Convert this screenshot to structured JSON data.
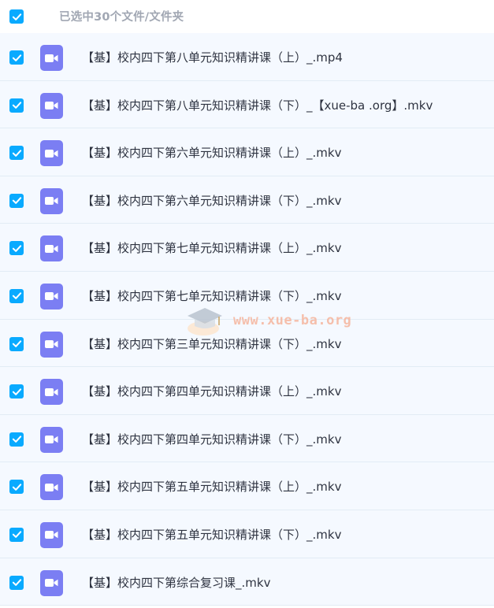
{
  "header": {
    "label": "已选中30个文件/文件夹"
  },
  "colors": {
    "checkbox": "#09aaff",
    "video_icon": "#7b7ef3",
    "row_bg": "#f5f9ff",
    "watermark_text": "#f6b9a3"
  },
  "files": [
    {
      "name": "【基】校内四下第八单元知识精讲课（上）_.mp4",
      "icon": "video-icon",
      "checked": true
    },
    {
      "name": "【基】校内四下第八单元知识精讲课（下）_【xue-ba .org】.mkv",
      "icon": "video-icon",
      "checked": true
    },
    {
      "name": "【基】校内四下第六单元知识精讲课（上）_.mkv",
      "icon": "video-icon",
      "checked": true
    },
    {
      "name": "【基】校内四下第六单元知识精讲课（下）_.mkv",
      "icon": "video-icon",
      "checked": true
    },
    {
      "name": "【基】校内四下第七单元知识精讲课（上）_.mkv",
      "icon": "video-icon",
      "checked": true
    },
    {
      "name": "【基】校内四下第七单元知识精讲课（下）_.mkv",
      "icon": "video-icon",
      "checked": true
    },
    {
      "name": "【基】校内四下第三单元知识精讲课（下）_.mkv",
      "icon": "video-icon",
      "checked": true
    },
    {
      "name": "【基】校内四下第四单元知识精讲课（上）_.mkv",
      "icon": "video-icon",
      "checked": true
    },
    {
      "name": "【基】校内四下第四单元知识精讲课（下）_.mkv",
      "icon": "video-icon",
      "checked": true
    },
    {
      "name": "【基】校内四下第五单元知识精讲课（上）_.mkv",
      "icon": "video-icon",
      "checked": true
    },
    {
      "name": "【基】校内四下第五单元知识精讲课（下）_.mkv",
      "icon": "video-icon",
      "checked": true
    },
    {
      "name": "【基】校内四下第综合复习课_.mkv",
      "icon": "video-icon",
      "checked": true
    }
  ],
  "watermark": {
    "text": "www.xue-ba.org"
  }
}
